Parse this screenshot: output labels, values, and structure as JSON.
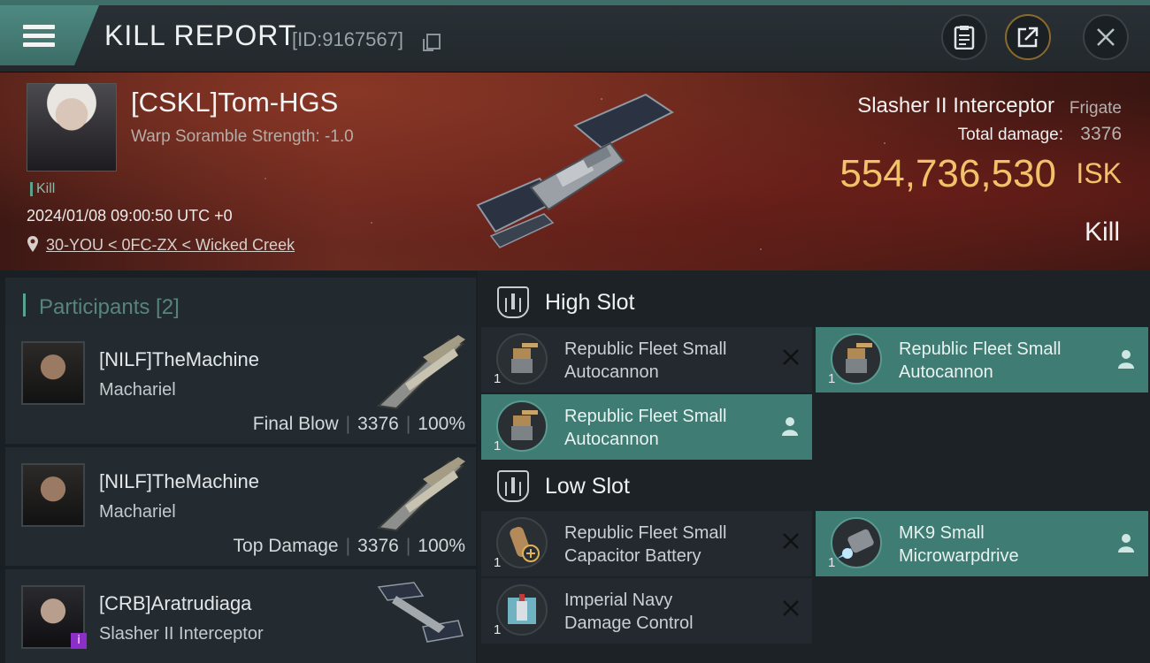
{
  "header": {
    "title": "KILL REPORT",
    "report_id": "[ID:9167567]"
  },
  "victim": {
    "name": "[CSKL]Tom-HGS",
    "scramble": "Warp Soramble Strength: -1.0",
    "tag": "Kill",
    "timestamp": "2024/01/08 09:00:50 UTC +0",
    "location": "30-YOU < 0FC-ZX < Wicked Creek",
    "ship_name": "Slasher II Interceptor",
    "ship_class": "Frigate",
    "damage_label": "Total damage:",
    "damage_value": "3376",
    "isk_value": "554,736,530",
    "isk_unit": "ISK",
    "result": "Kill"
  },
  "participants": {
    "label": "Participants [2]",
    "rows": [
      {
        "name": "[NILF]TheMachine",
        "ship": "Machariel",
        "role": "Final Blow",
        "damage": "3376",
        "percent": "100%"
      },
      {
        "name": "[NILF]TheMachine",
        "ship": "Machariel",
        "role": "Top Damage",
        "damage": "3376",
        "percent": "100%"
      },
      {
        "name": "[CRB]Aratrudiaga",
        "ship": "Slasher II Interceptor",
        "badge": "i"
      }
    ]
  },
  "fitting": {
    "high_slot_label": "High Slot",
    "low_slot_label": "Low Slot",
    "high": [
      {
        "line1": "Republic Fleet Small",
        "line2": "Autocannon",
        "qty": "1",
        "state": "destroyed"
      },
      {
        "line1": "Republic Fleet Small",
        "line2": "Autocannon",
        "qty": "1",
        "state": "dropped"
      },
      {
        "line1": "Republic Fleet Small",
        "line2": "Autocannon",
        "qty": "1",
        "state": "dropped"
      }
    ],
    "low": [
      {
        "line1": "Republic Fleet Small",
        "line2": "Capacitor Battery",
        "qty": "1",
        "state": "destroyed"
      },
      {
        "line1": "MK9 Small",
        "line2": "Microwarpdrive",
        "qty": "1",
        "state": "dropped"
      },
      {
        "line1": "Imperial Navy",
        "line2": "Damage Control",
        "qty": "1",
        "state": "destroyed"
      }
    ]
  },
  "icons": {
    "menu": "hamburger-icon",
    "copy": "copy-icon",
    "clipboard": "clipboard-icon",
    "share": "share-icon",
    "close": "close-icon",
    "location": "location-pin-icon",
    "destroyed": "x-icon",
    "dropped": "person-icon"
  },
  "colors": {
    "accent": "#5aa38e",
    "isk": "#f2c26b",
    "active_module": "#3e7c74"
  }
}
